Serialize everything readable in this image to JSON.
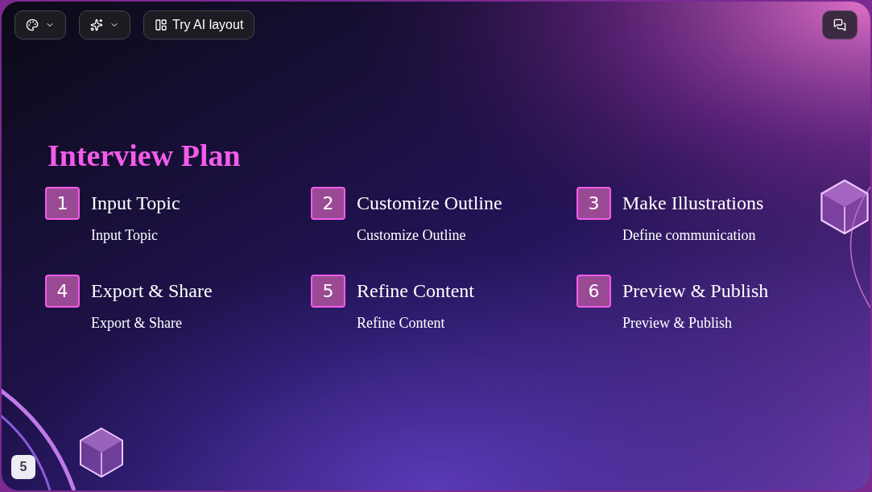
{
  "toolbar": {
    "ai_layout_button": "Try AI layout"
  },
  "slide": {
    "title": "Interview Plan",
    "steps": [
      {
        "number": "1",
        "heading": "Input Topic",
        "description": "Input Topic"
      },
      {
        "number": "2",
        "heading": "Customize Outline",
        "description": "Customize Outline"
      },
      {
        "number": "3",
        "heading": "Make Illustrations",
        "description": "Define communication"
      },
      {
        "number": "4",
        "heading": "Export & Share",
        "description": "Export & Share"
      },
      {
        "number": "5",
        "heading": "Refine Content",
        "description": "Refine Content"
      },
      {
        "number": "6",
        "heading": "Preview & Publish",
        "description": "Preview & Publish"
      }
    ]
  },
  "page_number": "5"
}
